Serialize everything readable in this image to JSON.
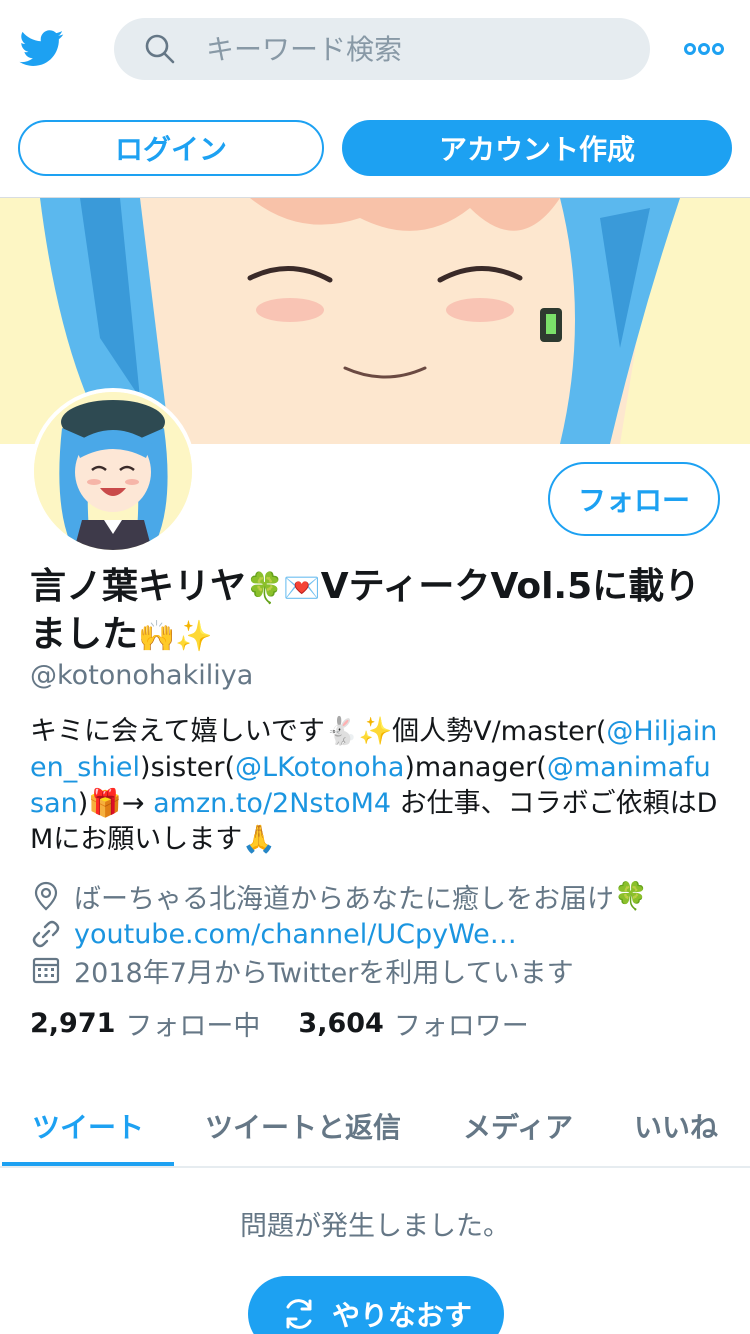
{
  "header": {
    "search_placeholder": "キーワード検索"
  },
  "auth": {
    "login_label": "ログイン",
    "signup_label": "アカウント作成"
  },
  "profile": {
    "follow_label": "フォロー",
    "name_part1": "言ノ葉キリヤ",
    "name_emoji1": "🍀",
    "name_emoji2": "💌",
    "name_part2": "Vティーク",
    "name_part3": "Vol.5に載りました",
    "name_emoji3": "🙌",
    "name_emoji4": "✨",
    "handle": "@kotonohakiliya",
    "bio": {
      "t1": "キミに会えて嬉しいです",
      "e1": "🐇",
      "e2": "✨",
      "t2": "個人勢V/master(",
      "l1": "@Hiljainen_shiel",
      "t3": ")sister(",
      "l2": "@LKotonoha",
      "t4": ")manager(",
      "l3": "@manimafusan",
      "t5": ")",
      "e3": "🎁",
      "t6": "→ ",
      "l4": "amzn.to/2NstoM4",
      "t7": " お仕事、コラボご依頼はDMにお願いします",
      "e4": "🙏"
    },
    "location": "ばーちゃる北海道からあなたに癒しをお届け",
    "location_emoji": "🍀",
    "website": "youtube.com/channel/UCpyWe…",
    "joined": "2018年7月からTwitterを利用しています",
    "following_count": "2,971",
    "following_label": "フォロー中",
    "followers_count": "3,604",
    "followers_label": "フォロワー"
  },
  "tabs": [
    {
      "label": "ツイート"
    },
    {
      "label": "ツイートと返信"
    },
    {
      "label": "メディア"
    },
    {
      "label": "いいね"
    }
  ],
  "error": {
    "message": "問題が発生しました。",
    "retry_label": "やりなおす"
  },
  "colors": {
    "accent": "#1da1f2",
    "link": "#1b95e0",
    "muted": "#657786"
  }
}
